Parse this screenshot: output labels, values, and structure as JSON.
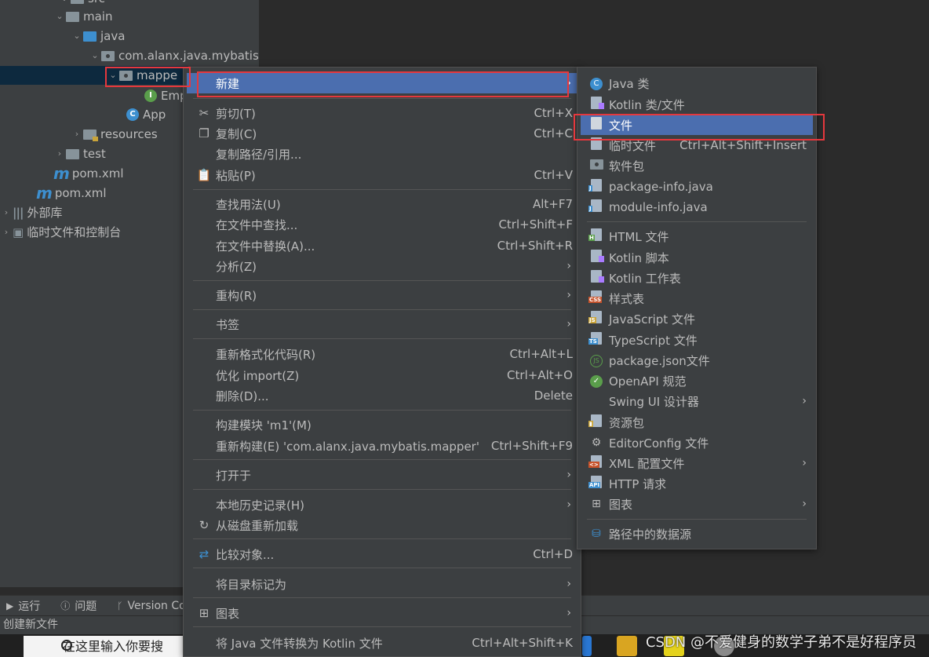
{
  "tree": {
    "src_partial": "src",
    "main": "main",
    "java": "java",
    "package": "com.alanx.java.mybatis",
    "mapper": "mappe",
    "emp": "Emp",
    "app": "App",
    "resources": "resources",
    "test": "test",
    "pom_inner": "pom.xml",
    "pom_outer": "pom.xml",
    "ext_lib": "外部库",
    "scratch": "临时文件和控制台"
  },
  "context_menu": {
    "new": "新建",
    "cut": "剪切(T)",
    "cut_sc": "Ctrl+X",
    "copy": "复制(C)",
    "copy_sc": "Ctrl+C",
    "copy_path": "复制路径/引用...",
    "paste": "粘贴(P)",
    "paste_sc": "Ctrl+V",
    "find_usages": "查找用法(U)",
    "find_usages_sc": "Alt+F7",
    "find_in_files": "在文件中查找...",
    "find_in_files_sc": "Ctrl+Shift+F",
    "replace_in_files": "在文件中替换(A)...",
    "replace_in_files_sc": "Ctrl+Shift+R",
    "analyze": "分析(Z)",
    "refactor": "重构(R)",
    "bookmarks": "书签",
    "reformat": "重新格式化代码(R)",
    "reformat_sc": "Ctrl+Alt+L",
    "optimize_imports": "优化 import(Z)",
    "optimize_imports_sc": "Ctrl+Alt+O",
    "delete": "删除(D)...",
    "delete_sc": "Delete",
    "build_module": "构建模块 'm1'(M)",
    "rebuild": "重新构建(E) 'com.alanx.java.mybatis.mapper'",
    "rebuild_sc": "Ctrl+Shift+F9",
    "open_in": "打开于",
    "local_history": "本地历史记录(H)",
    "reload_from_disk": "从磁盘重新加载",
    "compare_with": "比较对象...",
    "compare_with_sc": "Ctrl+D",
    "mark_directory": "将目录标记为",
    "diagrams": "图表",
    "convert_kotlin": "将 Java 文件转换为 Kotlin 文件",
    "convert_kotlin_sc": "Ctrl+Alt+Shift+K"
  },
  "submenu": {
    "java_class": "Java 类",
    "kotlin_class": "Kotlin 类/文件",
    "file": "文件",
    "scratch_file": "临时文件",
    "scratch_file_sc": "Ctrl+Alt+Shift+Insert",
    "package": "软件包",
    "package_info": "package-info.java",
    "module_info": "module-info.java",
    "html_file": "HTML 文件",
    "kotlin_script": "Kotlin 脚本",
    "kotlin_worksheet": "Kotlin 工作表",
    "stylesheet": "样式表",
    "js_file": "JavaScript 文件",
    "ts_file": "TypeScript 文件",
    "package_json": "package.json文件",
    "openapi": "OpenAPI 规范",
    "swing_ui": "Swing UI 设计器",
    "resource_bundle": "资源包",
    "editorconfig": "EditorConfig 文件",
    "xml_config": "XML 配置文件",
    "http_request": "HTTP 请求",
    "diagram": "图表",
    "data_source": "路径中的数据源"
  },
  "bottom_tabs": {
    "run": "运行",
    "problems": "问题",
    "version": "Version Co"
  },
  "status_text": "创建新文件",
  "taskbar": {
    "search": "在这里输入你要搜"
  },
  "watermark": "CSDN @不爱健身的数学子弟不是好程序员",
  "colors": {
    "highlight_box": "#e5383d",
    "menu_active": "#4b6eaf",
    "menu_bg": "#3c3f41"
  }
}
